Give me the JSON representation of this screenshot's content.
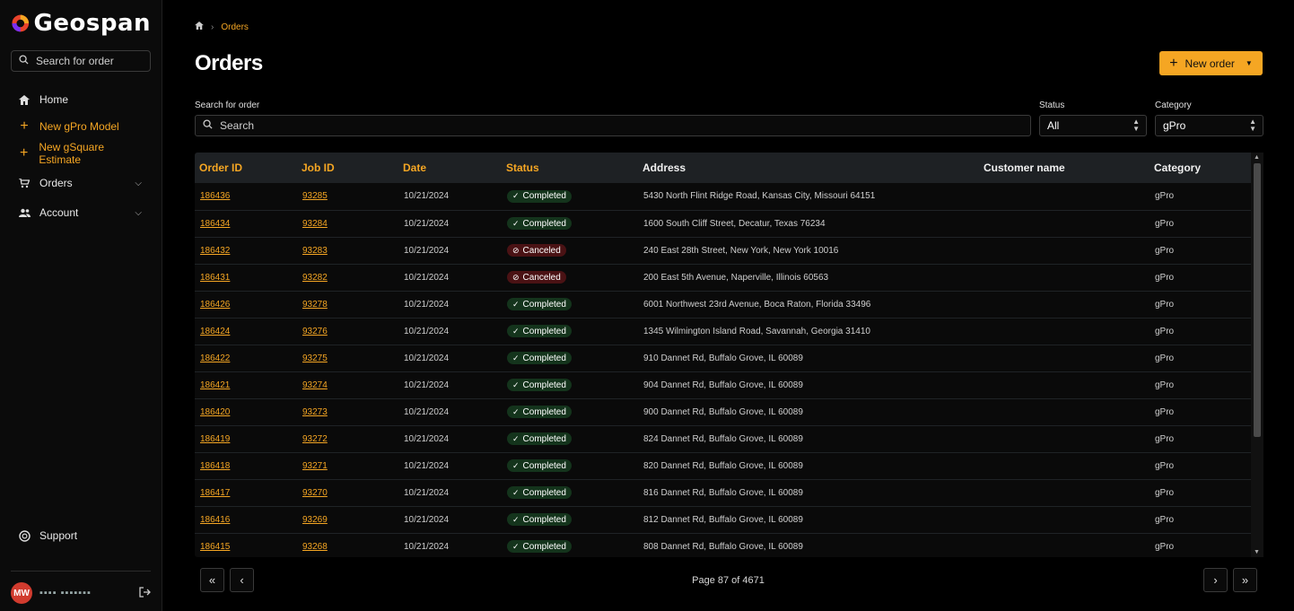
{
  "brand": {
    "name": "Geospan",
    "accent": "#f5a623"
  },
  "sidebar": {
    "search_placeholder": "Search for order",
    "items": [
      {
        "label": "Home",
        "icon": "home-icon"
      },
      {
        "label": "New gPro Model",
        "icon": "plus-icon"
      },
      {
        "label": "New gSquare Estimate",
        "icon": "plus-icon"
      },
      {
        "label": "Orders",
        "icon": "cart-icon"
      },
      {
        "label": "Account",
        "icon": "people-icon"
      }
    ],
    "support_label": "Support",
    "user_initials": "MW",
    "user_name": "▪▪▪▪ ▪▪▪▪▪▪▪"
  },
  "header": {
    "breadcrumb": "Orders",
    "title": "Orders",
    "new_order_label": "New order"
  },
  "filters": {
    "search_label": "Search for order",
    "search_placeholder": "Search",
    "status_label": "Status",
    "status_value": "All",
    "category_label": "Category",
    "category_value": "gPro"
  },
  "table": {
    "columns": [
      "Order ID",
      "Job ID",
      "Date",
      "Status",
      "Address",
      "Customer name",
      "Category"
    ],
    "rows": [
      {
        "order_id": "186436",
        "job_id": "93285",
        "date": "10/21/2024",
        "status": "Completed",
        "address": "5430 North Flint Ridge Road, Kansas City, Missouri 64151",
        "category": "gPro"
      },
      {
        "order_id": "186434",
        "job_id": "93284",
        "date": "10/21/2024",
        "status": "Completed",
        "address": "1600 South Cliff Street, Decatur, Texas 76234",
        "category": "gPro"
      },
      {
        "order_id": "186432",
        "job_id": "93283",
        "date": "10/21/2024",
        "status": "Canceled",
        "address": "240 East 28th Street, New York, New York 10016",
        "category": "gPro"
      },
      {
        "order_id": "186431",
        "job_id": "93282",
        "date": "10/21/2024",
        "status": "Canceled",
        "address": "200 East 5th Avenue, Naperville, Illinois 60563",
        "category": "gPro"
      },
      {
        "order_id": "186426",
        "job_id": "93278",
        "date": "10/21/2024",
        "status": "Completed",
        "address": "6001 Northwest 23rd Avenue, Boca Raton, Florida 33496",
        "category": "gPro"
      },
      {
        "order_id": "186424",
        "job_id": "93276",
        "date": "10/21/2024",
        "status": "Completed",
        "address": "1345 Wilmington Island Road, Savannah, Georgia 31410",
        "category": "gPro"
      },
      {
        "order_id": "186422",
        "job_id": "93275",
        "date": "10/21/2024",
        "status": "Completed",
        "address": "910 Dannet Rd, Buffalo Grove, IL 60089",
        "category": "gPro"
      },
      {
        "order_id": "186421",
        "job_id": "93274",
        "date": "10/21/2024",
        "status": "Completed",
        "address": "904 Dannet Rd, Buffalo Grove, IL 60089",
        "category": "gPro"
      },
      {
        "order_id": "186420",
        "job_id": "93273",
        "date": "10/21/2024",
        "status": "Completed",
        "address": "900 Dannet Rd, Buffalo Grove, IL 60089",
        "category": "gPro"
      },
      {
        "order_id": "186419",
        "job_id": "93272",
        "date": "10/21/2024",
        "status": "Completed",
        "address": "824 Dannet Rd, Buffalo Grove, IL 60089",
        "category": "gPro"
      },
      {
        "order_id": "186418",
        "job_id": "93271",
        "date": "10/21/2024",
        "status": "Completed",
        "address": "820 Dannet Rd, Buffalo Grove, IL 60089",
        "category": "gPro"
      },
      {
        "order_id": "186417",
        "job_id": "93270",
        "date": "10/21/2024",
        "status": "Completed",
        "address": "816 Dannet Rd, Buffalo Grove, IL 60089",
        "category": "gPro"
      },
      {
        "order_id": "186416",
        "job_id": "93269",
        "date": "10/21/2024",
        "status": "Completed",
        "address": "812 Dannet Rd, Buffalo Grove, IL 60089",
        "category": "gPro"
      },
      {
        "order_id": "186415",
        "job_id": "93268",
        "date": "10/21/2024",
        "status": "Completed",
        "address": "808 Dannet Rd, Buffalo Grove, IL 60089",
        "category": "gPro"
      }
    ]
  },
  "pagination": {
    "text": "Page 87 of 4671"
  },
  "colors": {
    "completed_bg": "#14341c",
    "canceled_bg": "#4a1214"
  }
}
